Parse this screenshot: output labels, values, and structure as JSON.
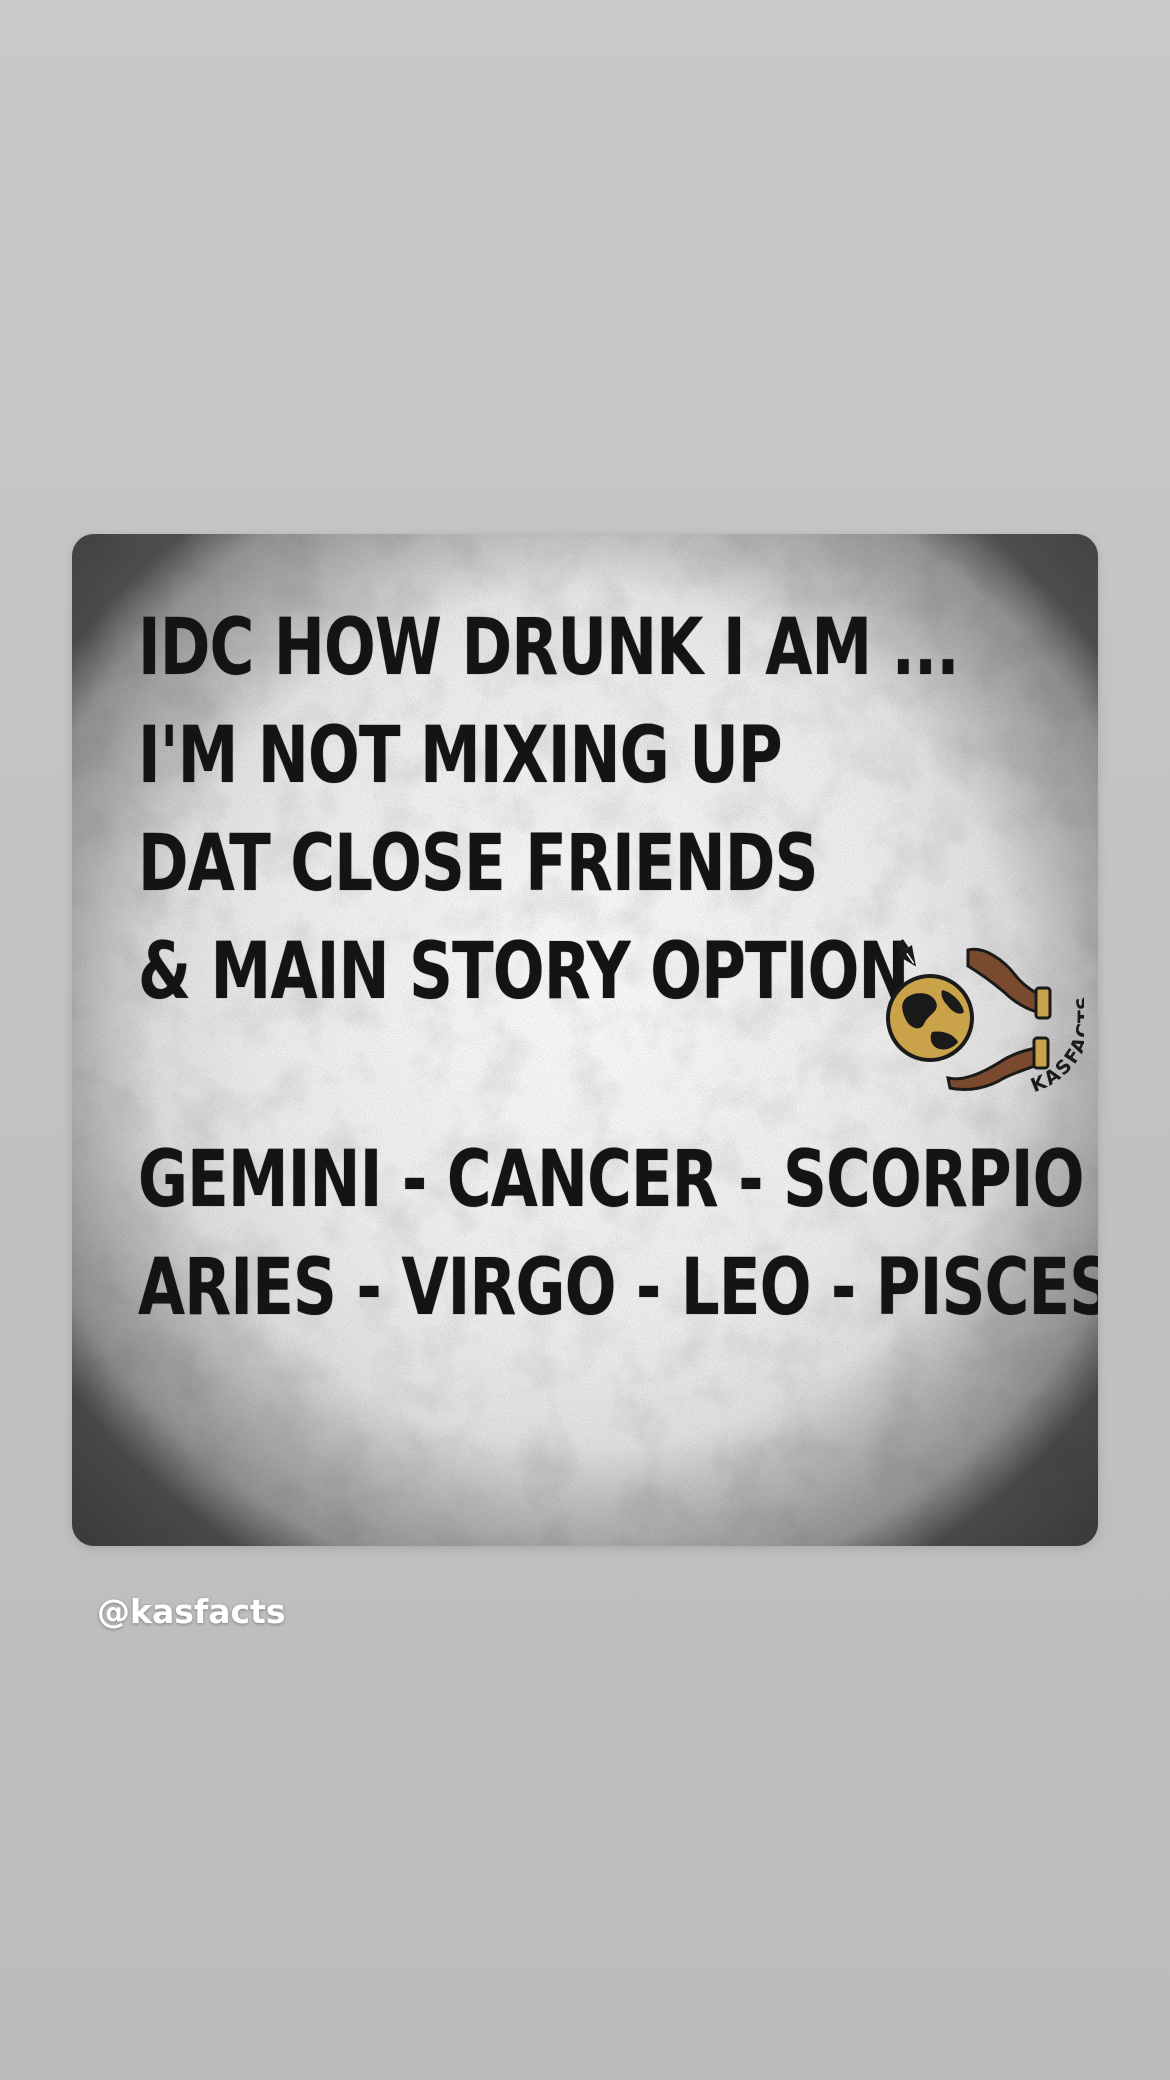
{
  "post": {
    "lines": [
      "IDC HOW DRUNK I AM ...",
      "I'M NOT MIXING UP",
      "DAT CLOSE FRIENDS",
      "& MAIN STORY OPTION"
    ],
    "signs": [
      "GEMINI - CANCER - SCORPIO",
      "ARIES - VIRGO - LEO - PISCES"
    ],
    "logo_text": "KASFACTS"
  },
  "mention": {
    "handle": "@kasfacts"
  },
  "colors": {
    "background": "#c4c4c4",
    "text": "#141414",
    "logo_gold": "#c9a24a",
    "logo_hand": "#7a4a2e"
  }
}
